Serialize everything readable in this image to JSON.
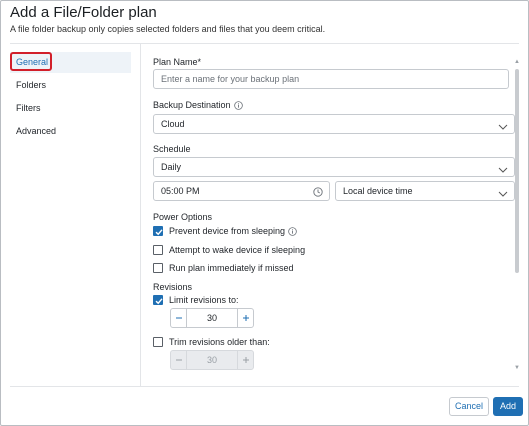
{
  "dialog": {
    "title": "Add a File/Folder plan",
    "subtitle": "A file folder backup only copies selected folders and files that you deem critical."
  },
  "sidebar": {
    "items": [
      {
        "label": "General",
        "active": true
      },
      {
        "label": "Folders",
        "active": false
      },
      {
        "label": "Filters",
        "active": false
      },
      {
        "label": "Advanced",
        "active": false
      }
    ]
  },
  "form": {
    "plan_name_label": "Plan Name*",
    "plan_name_placeholder": "Enter a name for your backup plan",
    "plan_name_value": "",
    "backup_destination_label": "Backup Destination",
    "backup_destination_value": "Cloud",
    "schedule_label": "Schedule",
    "schedule_value": "Daily",
    "time_value": "05:00 PM",
    "timezone_value": "Local device time",
    "power_options_label": "Power Options",
    "power_options": [
      {
        "label": "Prevent device from sleeping",
        "checked": true,
        "has_info": true
      },
      {
        "label": "Attempt to wake device if sleeping",
        "checked": false,
        "has_info": false
      },
      {
        "label": "Run plan immediately if missed",
        "checked": false,
        "has_info": false
      }
    ],
    "revisions_label": "Revisions",
    "limit_revisions": {
      "label": "Limit revisions to:",
      "checked": true,
      "value": "30"
    },
    "trim_revisions": {
      "label": "Trim revisions older than:",
      "checked": false,
      "value": "30"
    }
  },
  "footer": {
    "cancel_label": "Cancel",
    "add_label": "Add"
  },
  "colors": {
    "accent": "#1f6fb3",
    "highlight_border": "#d21f2a"
  }
}
